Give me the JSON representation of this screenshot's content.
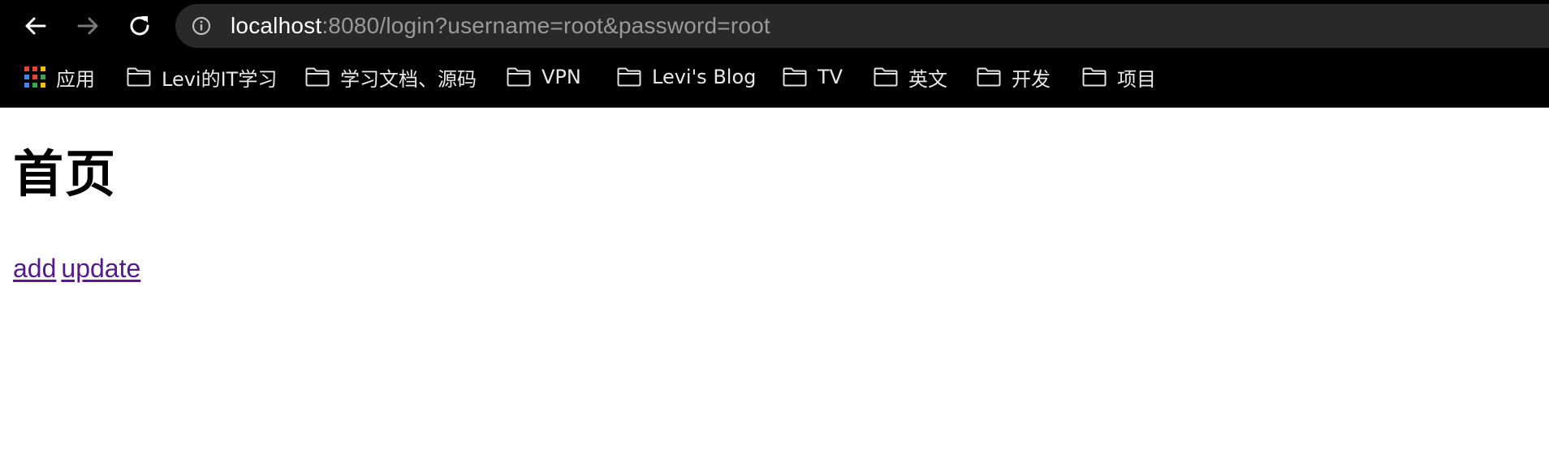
{
  "browser": {
    "url_host": "localhost",
    "url_rest": ":8080/login?username=root&password=root",
    "bookmarks": [
      {
        "label": "应用",
        "icon": "apps-grid-icon"
      },
      {
        "label": "Levi的IT学习",
        "icon": "folder-icon"
      },
      {
        "label": "学习文档、源码",
        "icon": "folder-icon"
      },
      {
        "label": "VPN",
        "icon": "folder-icon"
      },
      {
        "label": "Levi's Blog",
        "icon": "folder-icon"
      },
      {
        "label": "TV",
        "icon": "folder-icon"
      },
      {
        "label": "英文",
        "icon": "folder-icon"
      },
      {
        "label": "开发",
        "icon": "folder-icon"
      },
      {
        "label": "项目",
        "icon": "folder-icon"
      }
    ],
    "colors": {
      "chrome_bg": "#000000",
      "omnibox_bg": "#292929",
      "url_host": "#ffffff",
      "url_rest": "#9a9a9a"
    }
  },
  "page": {
    "title": "首页",
    "links": [
      {
        "label": "add"
      },
      {
        "label": "update"
      }
    ],
    "colors": {
      "link_visited": "#551a8b"
    }
  }
}
